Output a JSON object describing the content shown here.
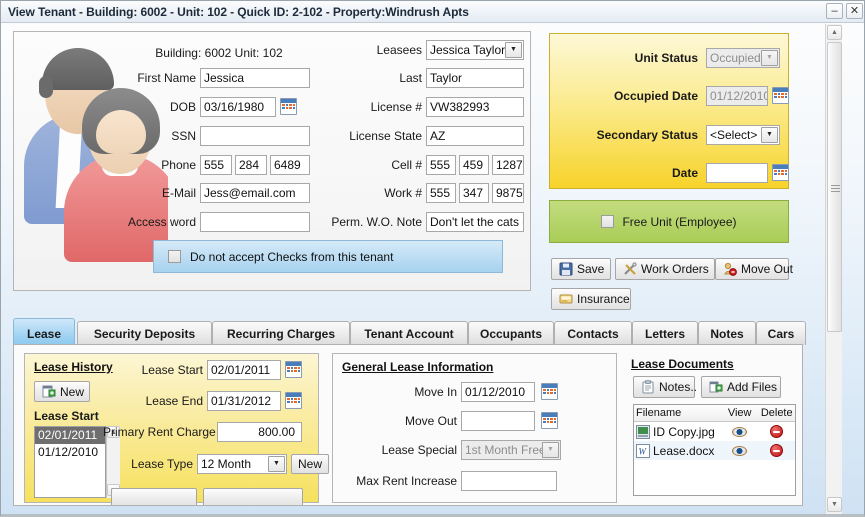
{
  "window": {
    "title": "View Tenant - Building: 6002 - Unit: 102 - Quick ID: 2-102 - Property:Windrush Apts",
    "minimize_label": "–",
    "close_label": "✕"
  },
  "tenant": {
    "building_unit_line": "Building: 6002 Unit: 102",
    "left_fields": [
      {
        "label": "First Name",
        "value": "Jessica"
      },
      {
        "label": "DOB",
        "value": "03/16/1980"
      },
      {
        "label": "SSN",
        "value": ""
      },
      {
        "label": "Phone",
        "value": ""
      },
      {
        "label": "E-Mail",
        "value": "Jess@email.com"
      },
      {
        "label": "Access word",
        "value": ""
      }
    ],
    "phone_parts": [
      "555",
      "284",
      "6489"
    ],
    "right_fields": [
      {
        "label": "Leasees",
        "value": "Jessica Taylor"
      },
      {
        "label": "Last",
        "value": "Taylor"
      },
      {
        "label": "License #",
        "value": "VW382993"
      },
      {
        "label": "License State",
        "value": "AZ"
      },
      {
        "label": "Cell #",
        "value": ""
      },
      {
        "label": "Work #",
        "value": ""
      },
      {
        "label": "Perm. W.O. Note",
        "value": "Don't let the cats out"
      }
    ],
    "cell_parts": [
      "555",
      "459",
      "1287"
    ],
    "work_parts": [
      "555",
      "347",
      "9875"
    ],
    "no_checks_label": "Do not accept Checks from this tenant"
  },
  "status_panel": {
    "unit_status_label": "Unit Status",
    "unit_status_value": "Occupied",
    "occupied_date_label": "Occupied Date",
    "occupied_date_value": "01/12/2010",
    "secondary_status_label": "Secondary Status",
    "secondary_status_value": "<Select>",
    "date_label": "Date",
    "date_value": ""
  },
  "free_unit": {
    "label": "Free Unit (Employee)"
  },
  "actions": {
    "save": "Save",
    "work_orders": "Work Orders",
    "move_out": "Move Out",
    "insurance": "Insurance"
  },
  "tabs": [
    {
      "label": "Lease",
      "active": true
    },
    {
      "label": "Security Deposits",
      "active": false
    },
    {
      "label": "Recurring Charges",
      "active": false
    },
    {
      "label": "Tenant Account",
      "active": false
    },
    {
      "label": "Occupants",
      "active": false
    },
    {
      "label": "Contacts",
      "active": false
    },
    {
      "label": "Letters",
      "active": false
    },
    {
      "label": "Notes",
      "active": false
    },
    {
      "label": "Cars",
      "active": false
    }
  ],
  "lease_history": {
    "heading": "Lease History",
    "new_button": "New",
    "list_header": "Lease Start",
    "items": [
      "02/01/2011",
      "01/12/2010"
    ],
    "selected_index": 0,
    "lease_start_label": "Lease Start",
    "lease_start_value": "02/01/2011",
    "lease_end_label": "Lease End",
    "lease_end_value": "01/31/2012",
    "primary_rent_label": "Primary Rent Charge",
    "primary_rent_value": "800.00",
    "lease_type_label": "Lease Type",
    "lease_type_value": "12 Month",
    "lease_type_new": "New"
  },
  "general_lease": {
    "heading": "General Lease Information",
    "move_in_label": "Move In",
    "move_in_value": "01/12/2010",
    "move_out_label": "Move Out",
    "move_out_value": "",
    "lease_special_label": "Lease Special",
    "lease_special_value": "1st Month Free",
    "max_rent_label": "Max Rent Increase",
    "max_rent_value": ""
  },
  "lease_documents": {
    "heading": "Lease Documents",
    "notes_button": "Notes..",
    "add_files_button": "Add Files",
    "columns": [
      "Filename",
      "View",
      "Delete"
    ],
    "rows": [
      {
        "filename": "ID Copy.jpg",
        "icon": "image-file-icon"
      },
      {
        "filename": "Lease.docx",
        "icon": "word-file-icon"
      }
    ]
  },
  "colors": {
    "accent_blue": "#86c6ee",
    "status_yellow": "#f7d32a",
    "free_green": "#a9cd57",
    "selection_gray": "#6e6e6e"
  }
}
